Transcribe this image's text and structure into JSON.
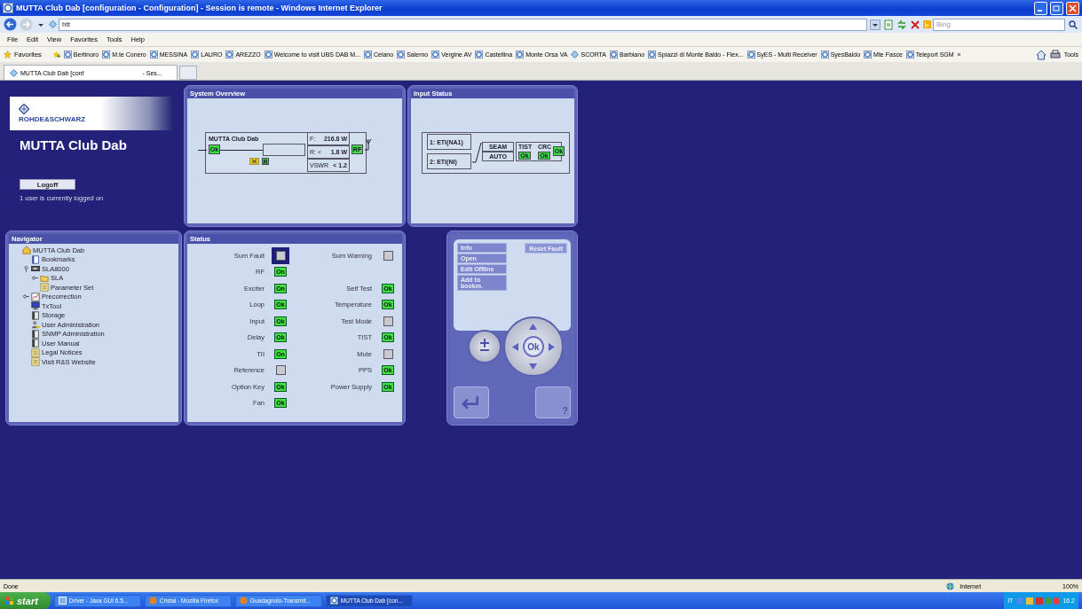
{
  "window": {
    "title": "MUTTA Club Dab [configuration - Configuration] - Session is remote - Windows Internet Explorer"
  },
  "address_bar": {
    "value": "htt"
  },
  "search": {
    "placeholder": "Bing"
  },
  "menu": [
    "File",
    "Edit",
    "View",
    "Favorites",
    "Tools",
    "Help"
  ],
  "favorites_bar": {
    "label": "Favorites",
    "overflow": "»",
    "tools": "Tools",
    "links": [
      {
        "label": "Bertinoro",
        "kind": "page"
      },
      {
        "label": "M.te Conero",
        "kind": "page"
      },
      {
        "label": "MESSINA",
        "kind": "page"
      },
      {
        "label": "LAURO",
        "kind": "page"
      },
      {
        "label": "AREZZO",
        "kind": "page"
      },
      {
        "label": "Welcome to visit UBS DAB M...",
        "kind": "page"
      },
      {
        "label": "Celano",
        "kind": "page"
      },
      {
        "label": "Salerno",
        "kind": "page"
      },
      {
        "label": "Vergine AV",
        "kind": "page"
      },
      {
        "label": "Castellina",
        "kind": "page"
      },
      {
        "label": "Monte Orsa VA",
        "kind": "page"
      },
      {
        "label": "SCORTA",
        "kind": "site"
      },
      {
        "label": "Barbiano",
        "kind": "page"
      },
      {
        "label": "Spiazzi di Monte Baldo - Flex...",
        "kind": "page"
      },
      {
        "label": "SyES - Multi Receiver",
        "kind": "page"
      },
      {
        "label": "SyesBaldo",
        "kind": "page"
      },
      {
        "label": "Mte Fasce",
        "kind": "page"
      },
      {
        "label": "Teleport SGM",
        "kind": "page"
      }
    ]
  },
  "tabs": [
    {
      "label_start": "MUTTA Club Dab [conf",
      "label_end": "- Ses...",
      "selected": true
    }
  ],
  "device": {
    "brand": "ROHDE&SCHWARZ",
    "name": "MUTTA Club Dab",
    "logoff": "Logoff",
    "session_info": "1 user is currently logged on"
  },
  "system_overview": {
    "title": "System Overview",
    "device_name": "MUTTA Club Dab",
    "status": "Ok",
    "remote": "R",
    "rf": "RF",
    "readings": [
      {
        "label": "F:",
        "value": "216.8 W"
      },
      {
        "label": "R: <",
        "value": "1.8 W"
      },
      {
        "label": "VSWR",
        "value": "< 1.2"
      }
    ]
  },
  "input_status": {
    "title": "Input Status",
    "inputs": [
      "1: ETI(NA1)",
      "2: ETI(NI)"
    ],
    "switch": [
      "SEAM",
      "AUTO"
    ],
    "checks": [
      {
        "label": "TIST",
        "value": "Ok"
      },
      {
        "label": "CRC",
        "value": "Ok"
      }
    ],
    "output": "Ok"
  },
  "navigator": {
    "title": "Navigator",
    "tree": [
      {
        "label": "MUTTA Club Dab",
        "kind": "home",
        "children": [
          {
            "label": "Bookmarks",
            "kind": "book"
          },
          {
            "label": "SLA8000",
            "kind": "device",
            "expanded": true,
            "children": [
              {
                "label": "SLA",
                "kind": "folder",
                "expanded": false
              },
              {
                "label": "Parameter Set",
                "kind": "sheet"
              }
            ]
          },
          {
            "label": "Precorrection",
            "kind": "chart",
            "expanded": false
          },
          {
            "label": "TxTool",
            "kind": "monitor"
          },
          {
            "label": "Storage",
            "kind": "drive"
          },
          {
            "label": "User Administration",
            "kind": "user"
          },
          {
            "label": "SNMP Administration",
            "kind": "drive"
          },
          {
            "label": "User Manual",
            "kind": "drive"
          },
          {
            "label": "Legal Notices",
            "kind": "sheet"
          },
          {
            "label": "Visit R&S Website",
            "kind": "sheet"
          }
        ]
      }
    ]
  },
  "status": {
    "title": "Status",
    "left": [
      {
        "label": "Sum Fault",
        "active": false,
        "selected": true
      },
      {
        "label": "RF",
        "active": true,
        "text": "On",
        "selected": false
      },
      {
        "label": "Exciter",
        "active": true,
        "text": "On",
        "selected": false
      },
      {
        "label": "Loop",
        "active": true,
        "text": "Ok",
        "selected": false
      },
      {
        "label": "Input",
        "active": true,
        "text": "Ok",
        "selected": false
      },
      {
        "label": "Delay",
        "active": true,
        "text": "Ok",
        "selected": false
      },
      {
        "label": "TII",
        "active": true,
        "text": "On",
        "selected": false
      },
      {
        "label": "Reference",
        "active": false,
        "selected": false
      },
      {
        "label": "Option Key",
        "active": true,
        "text": "Ok",
        "selected": false
      },
      {
        "label": "Fan",
        "active": true,
        "text": "Ok",
        "selected": false
      }
    ],
    "right": [
      {
        "label": "Sum Warning",
        "active": false,
        "selected": false
      },
      {
        "label": "Self Test",
        "active": true,
        "text": "Ok",
        "selected": false
      },
      {
        "label": "Temperature",
        "active": true,
        "text": "Ok",
        "selected": false
      },
      {
        "label": "Test Mode",
        "active": false,
        "selected": false
      },
      {
        "label": "TIST",
        "active": true,
        "text": "Ok",
        "selected": false
      },
      {
        "label": "Mute",
        "active": false,
        "selected": false
      },
      {
        "label": "PPS",
        "active": true,
        "text": "Ok",
        "selected": false
      },
      {
        "label": "Power Supply",
        "active": true,
        "text": "Ok",
        "selected": false
      }
    ]
  },
  "controls": {
    "menu": [
      "Info",
      "Open",
      "Edit Offline",
      "Add to bookm."
    ],
    "reset": "Reset Fault",
    "center": "Ok",
    "help": "?"
  },
  "status_bar": {
    "text": "Done",
    "zone": "Internet",
    "zoom": "100%"
  },
  "taskbar": {
    "start": "start",
    "language": "IT",
    "clock": "16.2",
    "tasks": [
      {
        "label": "Driver - Java GUI 6.5...",
        "kind": "java",
        "selected": false
      },
      {
        "label": "Cristal - Mozilla Firefox",
        "kind": "firefox",
        "selected": false
      },
      {
        "label": "Guadagnolo-Transmit...",
        "kind": "firefox",
        "selected": false
      },
      {
        "label": "MUTTA Club Dab [con...",
        "kind": "ie",
        "selected": true
      }
    ]
  }
}
